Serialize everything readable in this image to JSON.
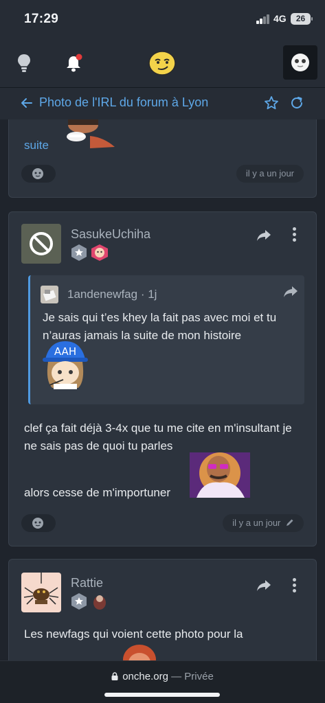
{
  "status_bar": {
    "time": "17:29",
    "network": "4G",
    "battery": "26"
  },
  "header": {
    "page_title": "Photo de l'IRL du forum à Lyon",
    "icons": [
      "bulb-icon",
      "bell-icon",
      "smiley-logo",
      "user-avatar",
      "back-arrow-icon",
      "star-icon",
      "refresh-icon"
    ]
  },
  "posts": [
    {
      "text": "suite",
      "timestamp": "il y a un jour"
    },
    {
      "username": "SasukeUchiha",
      "quote": {
        "author": "1andenewfag",
        "age": "· 1j",
        "text": "Je sais qui t’es khey la fait pas avec moi et tu n’auras jamais la suite de mon histoire",
        "sticker_text": "AAH"
      },
      "body_line1": "clef ça fait déjà 3-4x que tu me cite en m'insultant je ne sais pas de quoi tu parles",
      "body_line2": "alors cesse de m'importuner",
      "timestamp": "il y a un jour"
    },
    {
      "username": "Rattie",
      "body": "Les newfags qui voient cette photo pour la"
    }
  ],
  "browser": {
    "domain": "onche.org",
    "separator": " — ",
    "mode": "Privée"
  },
  "colors": {
    "accent": "#5ea8e8",
    "card": "#2c333d",
    "background": "#1f242c"
  }
}
